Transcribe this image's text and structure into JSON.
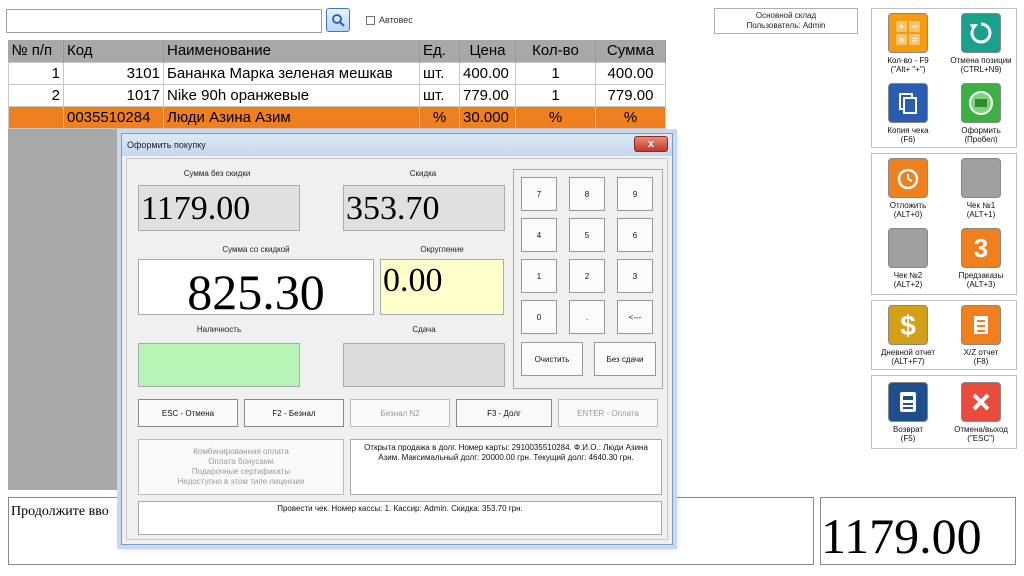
{
  "toolbar": {
    "search_value": "",
    "autoves_label": "Автовес",
    "store_name": "Основной склад",
    "user_label": "Пользователь: Admin"
  },
  "table": {
    "headers": [
      "№ п/п",
      "Код",
      "Наименование",
      "Ед.",
      "Цена",
      "Кол-во",
      "Сумма"
    ],
    "rows": [
      [
        "1",
        "3101",
        "Бананка Марка зеленая  мешкав",
        "шт.",
        "400.00",
        "1",
        "400.00"
      ],
      [
        "2",
        "1017",
        "Nike 90h оранжевые",
        "шт.",
        "779.00",
        "1",
        "779.00"
      ],
      [
        "",
        "0035510284",
        "Люди Азина Азим",
        "%",
        "30.000",
        "%",
        "%"
      ]
    ]
  },
  "right_panel": {
    "buttons": [
      {
        "label": "Кол-во - F9",
        "hint": "(\"Alt+ \"+\")",
        "icon": "calculator-icon",
        "color": "#f39c12"
      },
      {
        "label": "Отмена позиции",
        "hint": "(CTRL+N9)",
        "icon": "undo-icon",
        "color": "#1aa08c"
      },
      {
        "label": "Копия чека",
        "hint": "(F6)",
        "icon": "copy-icon",
        "color": "#2a5db0"
      },
      {
        "label": "Оформить",
        "hint": "(Пробел)",
        "icon": "money-icon",
        "color": "#3cb043"
      },
      {
        "label": "Отложить",
        "hint": "(ALT+0)",
        "icon": "alarm-icon",
        "color": "#f07f1e"
      },
      {
        "label": "Чек №1",
        "hint": "(ALT+1)",
        "icon": "blank-icon",
        "color": "#a0a0a0"
      },
      {
        "label": "Чек №2",
        "hint": "(ALT+2)",
        "icon": "blank-icon",
        "color": "#a0a0a0"
      },
      {
        "label": "Предзаказы",
        "hint": "(ALT+3)",
        "icon": "number-3-icon",
        "color": "#f07f1e"
      },
      {
        "label": "Дневной отчет",
        "hint": "(ALT+F7)",
        "icon": "dollar-icon",
        "color": "#d4a017"
      },
      {
        "label": "X/Z отчет",
        "hint": "(F8)",
        "icon": "report-icon",
        "color": "#f07f1e"
      },
      {
        "label": "Возврат",
        "hint": "(F5)",
        "icon": "cash-register-icon",
        "color": "#1f4e8c"
      },
      {
        "label": "Отмена/выход",
        "hint": "(\"ESC\")",
        "icon": "close-icon",
        "color": "#e74c3c"
      }
    ],
    "glyphs": {
      "3": "3",
      "dollar": "$"
    }
  },
  "dialog": {
    "title": "Оформить покупку",
    "close": "x",
    "sum_no_discount_label": "Сумма без скидки",
    "sum_no_discount": "1179.00",
    "discount_label": "Скидка",
    "discount": "353.70",
    "sum_with_discount_label": "Сумма со скидкой",
    "sum_with_discount": "825.30",
    "rounding_label": "Округление",
    "rounding": "0.00",
    "cash_label": "Наличность",
    "cash_value": "",
    "change_label": "Сдача",
    "change_value": "",
    "keypad": [
      "7",
      "8",
      "9",
      "4",
      "5",
      "6",
      "1",
      "2",
      "3",
      "0",
      ".",
      "<---"
    ],
    "clear_label": "Очистить",
    "no_change_label": "Без сдачи",
    "esc_label": "ESC - Отмена",
    "f2_label": "F2 - Безнал",
    "beznal2_label": "Безнал N2",
    "f3_label": "F3 - Долг",
    "enter_label": "ENTER - Оплата",
    "combined_lines": [
      "Комбинированная оплата",
      "Оплата бонусами",
      "Подарочные сертификаты",
      "Недоступно в этом типе лицензии"
    ],
    "info_text": "Открыта продажа в долг. Номер карты: 2910035510284. Ф.И.О.:  Люди Азина Азим. Максимальный долг: 20000.00 грн. Текущий долг: 4640.30 грн.",
    "status_text": "Провести чек. Номер кассы: 1. Кассир: Admin. Скидка: 353.70 грн."
  },
  "bottom": {
    "message": "Продолжите вво",
    "total": "1179.00"
  }
}
